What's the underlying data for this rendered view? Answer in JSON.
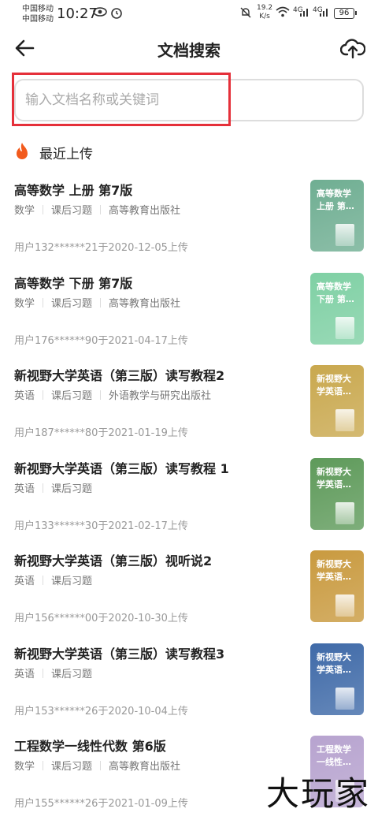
{
  "status_bar": {
    "carrier1": "中国移动",
    "carrier2": "中国移动",
    "time": "10:27",
    "net_speed_value": "19.2",
    "net_speed_unit": "K/s",
    "signal1": "4G",
    "signal2": "4G",
    "battery": "96"
  },
  "header": {
    "title": "文档搜索"
  },
  "search": {
    "placeholder": "输入文档名称或关键词",
    "value": ""
  },
  "section": {
    "title": "最近上传"
  },
  "documents": [
    {
      "title": "高等数学 上册 第7版",
      "tags": [
        "数学",
        "课后习题",
        "高等教育出版社"
      ],
      "meta": "用户132******21于2020-12-05上传",
      "cover_text": "高等数学上册 第…",
      "cover_color": "#6fae92"
    },
    {
      "title": "高等数学 下册 第7版",
      "tags": [
        "数学",
        "课后习题",
        "高等教育出版社"
      ],
      "meta": "用户176******90于2021-04-17上传",
      "cover_text": "高等数学下册 第…",
      "cover_color": "#7fd0a4"
    },
    {
      "title": "新视野大学英语（第三版）读写教程2",
      "tags": [
        "英语",
        "课后习题",
        "外语教学与研究出版社"
      ],
      "meta": "用户187******80于2021-01-19上传",
      "cover_text": "新视野大学英语…",
      "cover_color": "#c9a84e"
    },
    {
      "title": "新视野大学英语（第三版）读写教程 1",
      "tags": [
        "英语",
        "课后习题"
      ],
      "meta": "用户133******30于2021-02-17上传",
      "cover_text": "新视野大学英语…",
      "cover_color": "#5e9a5a"
    },
    {
      "title": "新视野大学英语（第三版）视听说2",
      "tags": [
        "英语",
        "课后习题"
      ],
      "meta": "用户156******00于2020-10-30上传",
      "cover_text": "新视野大学英语…",
      "cover_color": "#c99a3f"
    },
    {
      "title": "新视野大学英语（第三版）读写教程3",
      "tags": [
        "英语",
        "课后习题"
      ],
      "meta": "用户153******26于2020-10-04上传",
      "cover_text": "新视野大学英语…",
      "cover_color": "#3f6aa8"
    },
    {
      "title": "工程数学一线性代数 第6版",
      "tags": [
        "数学",
        "课后习题",
        "高等教育出版社"
      ],
      "meta": "用户155******26于2021-01-09上传",
      "cover_text": "工程数学一线性…",
      "cover_color": "#b7a3cf"
    }
  ],
  "watermark": "大玩家",
  "colors": {
    "highlight": "#e5303a",
    "flame": "#f25a1c"
  },
  "icons": {
    "back": "arrow-left",
    "upload": "cloud-upload",
    "flame": "fire"
  }
}
